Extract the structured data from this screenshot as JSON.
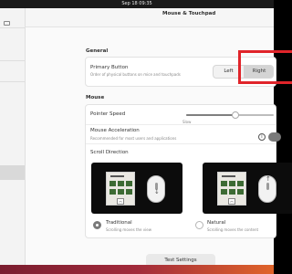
{
  "topbar": {
    "datetime": "Sep 18  09:35"
  },
  "window": {
    "title": "Mouse & Touchpad"
  },
  "general": {
    "section_title": "General",
    "primary_button_label": "Primary Button",
    "primary_button_sub": "Order of physical buttons on mice and touchpads",
    "left_label": "Left",
    "right_label": "Right",
    "selected": "Right"
  },
  "mouse": {
    "section_title": "Mouse",
    "pointer_speed_label": "Pointer Speed",
    "pointer_speed_slow": "Slow",
    "pointer_speed_value": 0.55,
    "accel_label": "Mouse Acceleration",
    "accel_sub": "Recommended for most users and applications",
    "accel_enabled": true,
    "scroll_direction_label": "Scroll Direction",
    "traditional_label": "Traditional",
    "traditional_sub": "Scrolling moves the view",
    "natural_label": "Natural",
    "natural_sub": "Scrolling moves the content",
    "selected_scroll": "Traditional"
  },
  "actions": {
    "test_settings": "Test Settings"
  },
  "icons": {
    "info": "info-icon",
    "toggle": "toggle-switch"
  },
  "colors": {
    "annotation": "#e0242a",
    "dock_start": "#7a1d2f",
    "dock_end": "#e0642a"
  }
}
